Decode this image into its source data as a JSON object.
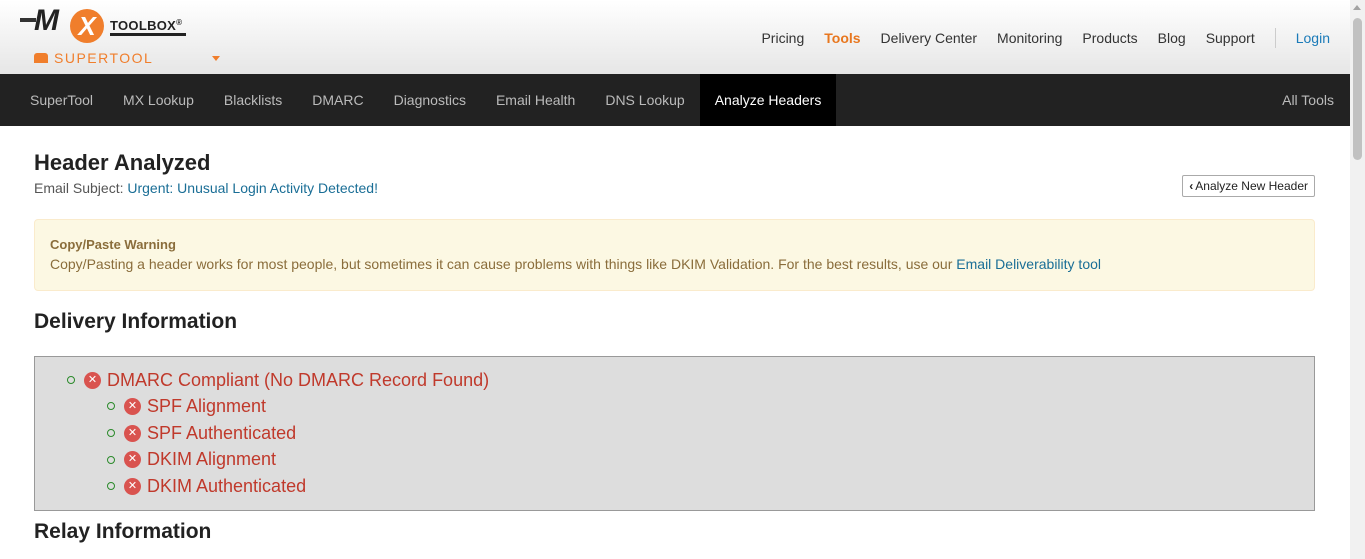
{
  "brand": {
    "logo_mx": "MX",
    "logo_toolbox": "TOOLBOX",
    "product": "SUPERTOOL"
  },
  "topnav": {
    "items": [
      "Pricing",
      "Tools",
      "Delivery Center",
      "Monitoring",
      "Products",
      "Blog",
      "Support"
    ],
    "active": "Tools",
    "login": "Login"
  },
  "subnav": {
    "tabs": [
      "SuperTool",
      "MX Lookup",
      "Blacklists",
      "DMARC",
      "Diagnostics",
      "Email Health",
      "DNS Lookup",
      "Analyze Headers"
    ],
    "active": "Analyze Headers",
    "all_tools": "All Tools"
  },
  "page": {
    "title": "Header Analyzed",
    "subject_label": "Email Subject:",
    "subject_value": "Urgent: Unusual Login Activity Detected!",
    "analyze_new_button": "Analyze New Header"
  },
  "warning": {
    "title": "Copy/Paste Warning",
    "text": "Copy/Pasting a header works for most people, but sometimes it can cause problems with things like DKIM Validation. For the best results, use our ",
    "link_text": "Email Deliverability tool"
  },
  "delivery": {
    "title": "Delivery Information",
    "root": "DMARC Compliant (No DMARC Record Found)",
    "children": [
      "SPF Alignment",
      "SPF Authenticated",
      "DKIM Alignment",
      "DKIM Authenticated"
    ],
    "status": "fail",
    "status_color": "#c0392b"
  },
  "relay": {
    "title": "Relay Information"
  }
}
